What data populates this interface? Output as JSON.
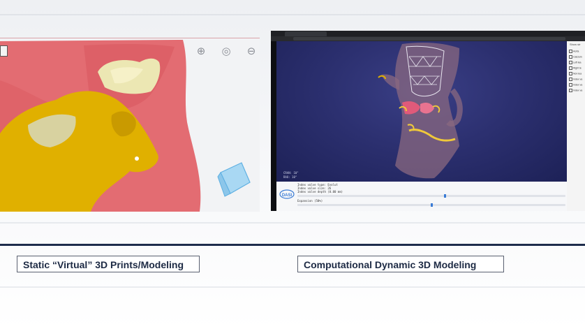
{
  "left_panel": {
    "toolbar": {
      "zoom_in_icon": "zoom-in-icon",
      "reset_icon": "reset-view-icon",
      "zoom_out_icon": "zoom-out-icon"
    }
  },
  "right_panel": {
    "legend": {
      "title": "Show str",
      "items": [
        "Aorta",
        "Calcium",
        "Left lea",
        "Right le",
        "Non lea",
        "Index va",
        "Index va",
        "Index va"
      ]
    },
    "angles": {
      "cran": "CRAN: 10°",
      "rao": "RAO: 10°"
    },
    "controls": {
      "logo_text": "DASI",
      "valve_type": "Index valve type: Evolut",
      "valve_size": "Index valve size: 26",
      "valve_depth": "Index valve depth (0.00 mm)",
      "expansion": "Expansion (50%)",
      "depth_fraction": 0.55,
      "expansion_fraction": 0.5
    }
  },
  "captions": {
    "left": "Static “Virtual” 3D Prints/Modeling",
    "right": "Computational Dynamic 3D Modeling"
  },
  "colors": {
    "caption_text": "#1d2a44",
    "divider": "#1e2c4c",
    "viewport_bg": "#2c3070",
    "tissue": "#e67378",
    "calcium": "#e3b500"
  }
}
